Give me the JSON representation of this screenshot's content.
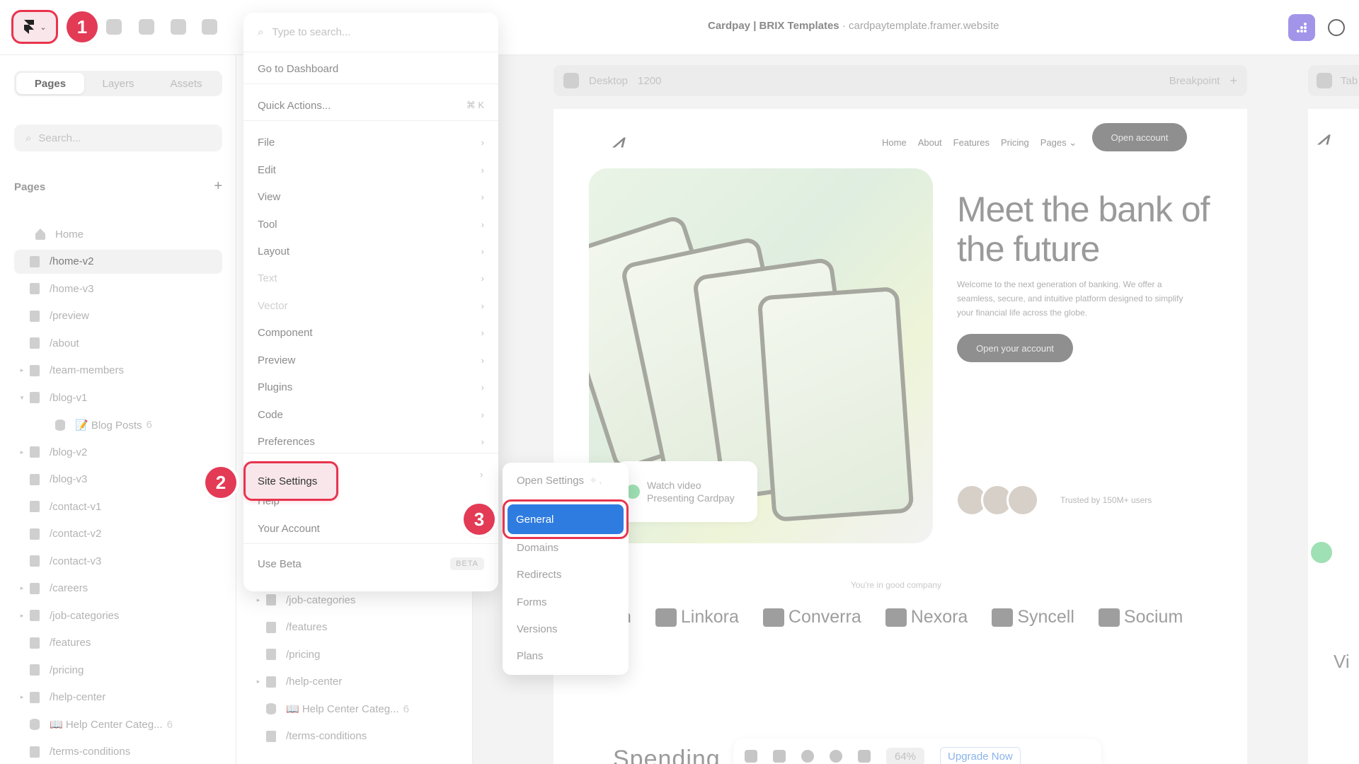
{
  "toolbar": {
    "title_main": "Cardpay | BRIX Templates",
    "title_sep": " · ",
    "title_url": "cardpaytemplate.framer.website",
    "chevron": "⌄"
  },
  "steps": [
    "1",
    "2",
    "3"
  ],
  "left_panel": {
    "tabs": [
      "Pages",
      "Layers",
      "Assets"
    ],
    "search_placeholder": "Search...",
    "pages_header": "Pages",
    "add_icon": "+",
    "pages": [
      {
        "label": "Home",
        "icon": "home",
        "arrow": ""
      },
      {
        "label": "/home-v2",
        "icon": "page",
        "arrow": "",
        "selected": true
      },
      {
        "label": "/home-v3",
        "icon": "page",
        "arrow": ""
      },
      {
        "label": "/preview",
        "icon": "page",
        "arrow": ""
      },
      {
        "label": "/about",
        "icon": "page",
        "arrow": ""
      },
      {
        "label": "/team-members",
        "icon": "page",
        "arrow": "▸"
      },
      {
        "label": "/blog-v1",
        "icon": "page",
        "arrow": "▾"
      },
      {
        "label": "📝 Blog Posts",
        "icon": "db",
        "arrow": "",
        "count": "6",
        "indent": true
      },
      {
        "label": "/blog-v2",
        "icon": "page",
        "arrow": "▸"
      },
      {
        "label": "/blog-v3",
        "icon": "page",
        "arrow": ""
      },
      {
        "label": "/contact-v1",
        "icon": "page",
        "arrow": ""
      },
      {
        "label": "/contact-v2",
        "icon": "page",
        "arrow": ""
      },
      {
        "label": "/contact-v3",
        "icon": "page",
        "arrow": ""
      },
      {
        "label": "/careers",
        "icon": "page",
        "arrow": "▸"
      },
      {
        "label": "/job-categories",
        "icon": "page",
        "arrow": "▸"
      },
      {
        "label": "/features",
        "icon": "page",
        "arrow": ""
      },
      {
        "label": "/pricing",
        "icon": "page",
        "arrow": ""
      },
      {
        "label": "/help-center",
        "icon": "page",
        "arrow": "▸"
      },
      {
        "label": "📖 Help Center Categ...",
        "icon": "db",
        "arrow": "",
        "count": "6"
      },
      {
        "label": "/terms-conditions",
        "icon": "page",
        "arrow": ""
      }
    ]
  },
  "mid_list": [
    {
      "label": "/job-categories",
      "icon": "page",
      "arrow": "▸"
    },
    {
      "label": "/features",
      "icon": "page",
      "arrow": ""
    },
    {
      "label": "/pricing",
      "icon": "page",
      "arrow": ""
    },
    {
      "label": "/help-center",
      "icon": "page",
      "arrow": "▸"
    },
    {
      "label": "📖 Help Center Categ...",
      "icon": "db",
      "arrow": "",
      "count": "6"
    },
    {
      "label": "/terms-conditions",
      "icon": "page",
      "arrow": ""
    }
  ],
  "main_menu": {
    "search_placeholder": "Type to search...",
    "items": [
      {
        "label": "Go to Dashboard",
        "right": ""
      },
      {
        "label": "Quick Actions...",
        "right": "⌘ K"
      },
      {
        "label": "File",
        "right": "›"
      },
      {
        "label": "Edit",
        "right": "›"
      },
      {
        "label": "View",
        "right": "›"
      },
      {
        "label": "Tool",
        "right": "›"
      },
      {
        "label": "Layout",
        "right": "›"
      },
      {
        "label": "Text",
        "right": "›",
        "disabled": true
      },
      {
        "label": "Vector",
        "right": "›",
        "disabled": true
      },
      {
        "label": "Component",
        "right": "›"
      },
      {
        "label": "Preview",
        "right": "›"
      },
      {
        "label": "Plugins",
        "right": "›"
      },
      {
        "label": "Code",
        "right": "›"
      },
      {
        "label": "Preferences",
        "right": "›"
      },
      {
        "label": "Site Settings",
        "right": "›"
      },
      {
        "label": "Help",
        "right": ""
      },
      {
        "label": "Your Account",
        "right": ""
      },
      {
        "label": "Use Beta",
        "right": "BETA"
      }
    ]
  },
  "submenu": {
    "items": [
      "Open Settings",
      "General",
      "Domains",
      "Redirects",
      "Forms",
      "Versions",
      "Plans"
    ],
    "gear": "✧ ,"
  },
  "canvas": {
    "frame_label": "Desktop",
    "frame_width": "1200",
    "breakpoint": "Breakpoint",
    "breakpoint_add": "+",
    "frame2_label": "Tab",
    "site": {
      "nav_links": [
        "Home",
        "About",
        "Features",
        "Pricing",
        "Pages ⌄"
      ],
      "nav_button": "Open account",
      "hero_title": "Meet the bank of the future",
      "hero_text": "Welcome to the next generation of banking. We offer a seamless, secure, and intuitive platform designed to simplify your financial life across the globe.",
      "hero_button": "Open your account",
      "trusted": "Trusted by 150M+ users",
      "watch_line1": "Watch video",
      "watch_line2": "Presenting Cardpay",
      "company": "You're in good company",
      "brands": [
        "n",
        "Linkora",
        "Converra",
        "Nexora",
        "Syncell",
        "Socium"
      ],
      "spending": "Spending",
      "side_brand": "Vi"
    },
    "bottom_toolbar": {
      "zoom": "64%",
      "upgrade": "Upgrade Now"
    }
  }
}
